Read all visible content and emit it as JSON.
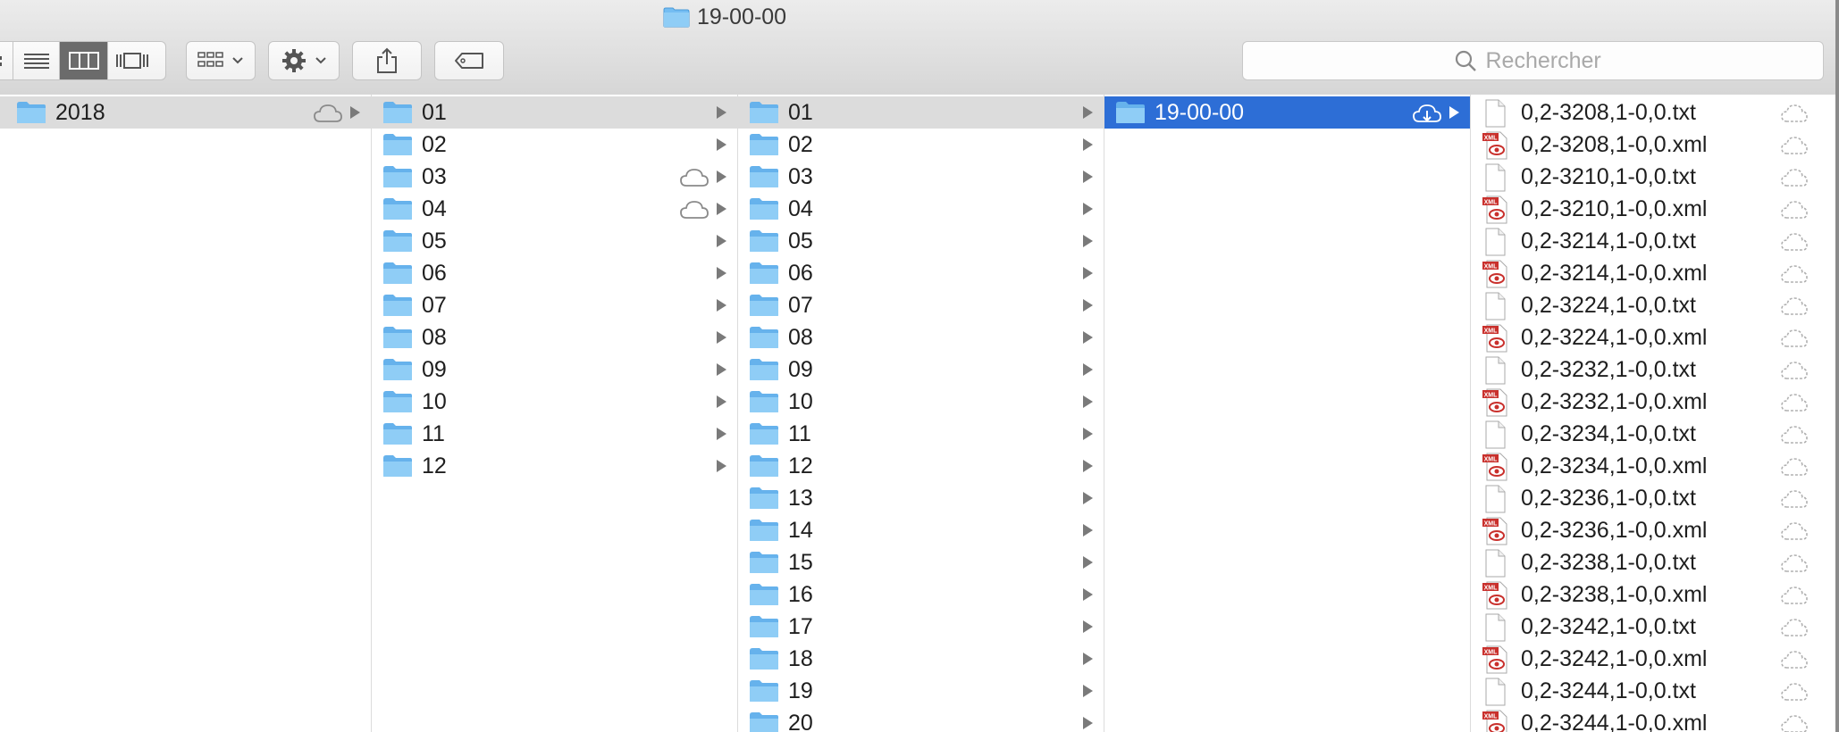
{
  "window": {
    "title": "19-00-00"
  },
  "toolbar": {
    "view_icons": [
      "icon-view-icon",
      "list-view-icon",
      "column-view-icon",
      "gallery-view-icon"
    ],
    "active_view": "column-view-icon",
    "search": {
      "placeholder": "Rechercher"
    }
  },
  "columns": [
    {
      "items": [
        {
          "label": "2018",
          "selected": "grey",
          "cloud": true
        }
      ]
    },
    {
      "items": [
        {
          "label": "01",
          "selected": "grey",
          "cloud": false
        },
        {
          "label": "02",
          "cloud": false
        },
        {
          "label": "03",
          "cloud": true
        },
        {
          "label": "04",
          "cloud": true
        },
        {
          "label": "05",
          "cloud": false
        },
        {
          "label": "06",
          "cloud": false
        },
        {
          "label": "07",
          "cloud": false
        },
        {
          "label": "08",
          "cloud": false
        },
        {
          "label": "09",
          "cloud": false
        },
        {
          "label": "10",
          "cloud": false
        },
        {
          "label": "11",
          "cloud": false
        },
        {
          "label": "12",
          "cloud": false
        }
      ]
    },
    {
      "items": [
        {
          "label": "01",
          "selected": "grey"
        },
        {
          "label": "02"
        },
        {
          "label": "03"
        },
        {
          "label": "04"
        },
        {
          "label": "05"
        },
        {
          "label": "06"
        },
        {
          "label": "07"
        },
        {
          "label": "08"
        },
        {
          "label": "09"
        },
        {
          "label": "10"
        },
        {
          "label": "11"
        },
        {
          "label": "12"
        },
        {
          "label": "13"
        },
        {
          "label": "14"
        },
        {
          "label": "15"
        },
        {
          "label": "16"
        },
        {
          "label": "17"
        },
        {
          "label": "18"
        },
        {
          "label": "19"
        },
        {
          "label": "20"
        }
      ]
    },
    {
      "items": [
        {
          "label": "19-00-00",
          "selected": "blue",
          "cloud_download": true
        }
      ]
    }
  ],
  "files": [
    {
      "name": "0,2-3208,1-0,0.txt",
      "type": "txt"
    },
    {
      "name": "0,2-3208,1-0,0.xml",
      "type": "xml"
    },
    {
      "name": "0,2-3210,1-0,0.txt",
      "type": "txt"
    },
    {
      "name": "0,2-3210,1-0,0.xml",
      "type": "xml"
    },
    {
      "name": "0,2-3214,1-0,0.txt",
      "type": "txt"
    },
    {
      "name": "0,2-3214,1-0,0.xml",
      "type": "xml"
    },
    {
      "name": "0,2-3224,1-0,0.txt",
      "type": "txt"
    },
    {
      "name": "0,2-3224,1-0,0.xml",
      "type": "xml"
    },
    {
      "name": "0,2-3232,1-0,0.txt",
      "type": "txt"
    },
    {
      "name": "0,2-3232,1-0,0.xml",
      "type": "xml"
    },
    {
      "name": "0,2-3234,1-0,0.txt",
      "type": "txt"
    },
    {
      "name": "0,2-3234,1-0,0.xml",
      "type": "xml"
    },
    {
      "name": "0,2-3236,1-0,0.txt",
      "type": "txt"
    },
    {
      "name": "0,2-3236,1-0,0.xml",
      "type": "xml"
    },
    {
      "name": "0,2-3238,1-0,0.txt",
      "type": "txt"
    },
    {
      "name": "0,2-3238,1-0,0.xml",
      "type": "xml"
    },
    {
      "name": "0,2-3242,1-0,0.txt",
      "type": "txt"
    },
    {
      "name": "0,2-3242,1-0,0.xml",
      "type": "xml"
    },
    {
      "name": "0,2-3244,1-0,0.txt",
      "type": "txt"
    },
    {
      "name": "0,2-3244,1-0,0.xml",
      "type": "xml"
    }
  ],
  "colors": {
    "selection_blue": "#2d6ed6",
    "selection_grey": "#dcdcdc",
    "folder_blue": "#6cb6ef",
    "xml_badge_red": "#c9302c"
  }
}
